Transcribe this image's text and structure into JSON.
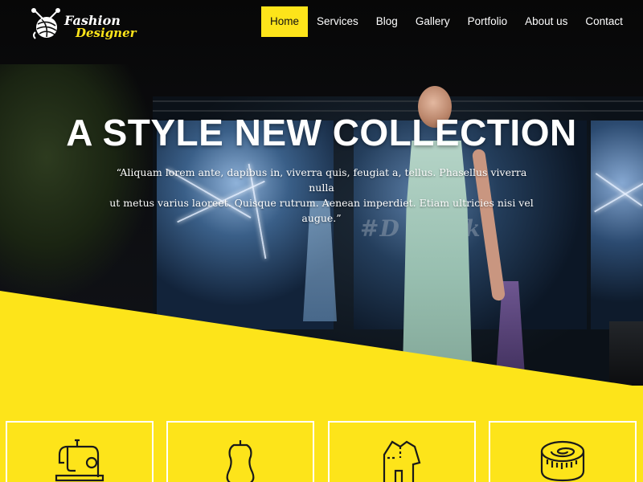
{
  "brand": {
    "logo_line1": "Fashion",
    "logo_line2": "Designer",
    "logo_icon": "yarn-ball-icon"
  },
  "nav": {
    "items": [
      {
        "label": "Home",
        "active": true
      },
      {
        "label": "Services",
        "active": false
      },
      {
        "label": "Blog",
        "active": false
      },
      {
        "label": "Gallery",
        "active": false
      },
      {
        "label": "Portfolio",
        "active": false
      },
      {
        "label": "About us",
        "active": false
      },
      {
        "label": "Contact",
        "active": false
      }
    ]
  },
  "hero": {
    "title": "A STYLE NEW COLLECTION",
    "quote_line1": "“Aliquam lorem ante, dapibus in, viverra quis, feugiat a, tellus. Phasellus viverra nulla",
    "quote_line2": "ut metus varius laoreet. Quisque rutrum. Aenean imperdiet. Etiam ultricies nisi vel augue.”",
    "background_text": "#D        twalk"
  },
  "features": [
    {
      "icon": "sewing-machine-icon"
    },
    {
      "icon": "dress-form-icon"
    },
    {
      "icon": "shirt-pattern-icon"
    },
    {
      "icon": "measuring-tape-icon"
    }
  ],
  "colors": {
    "accent": "#fde41a",
    "hero_dark": "#0a0a0a",
    "text_light": "#ffffff",
    "text_dark": "#111111"
  }
}
